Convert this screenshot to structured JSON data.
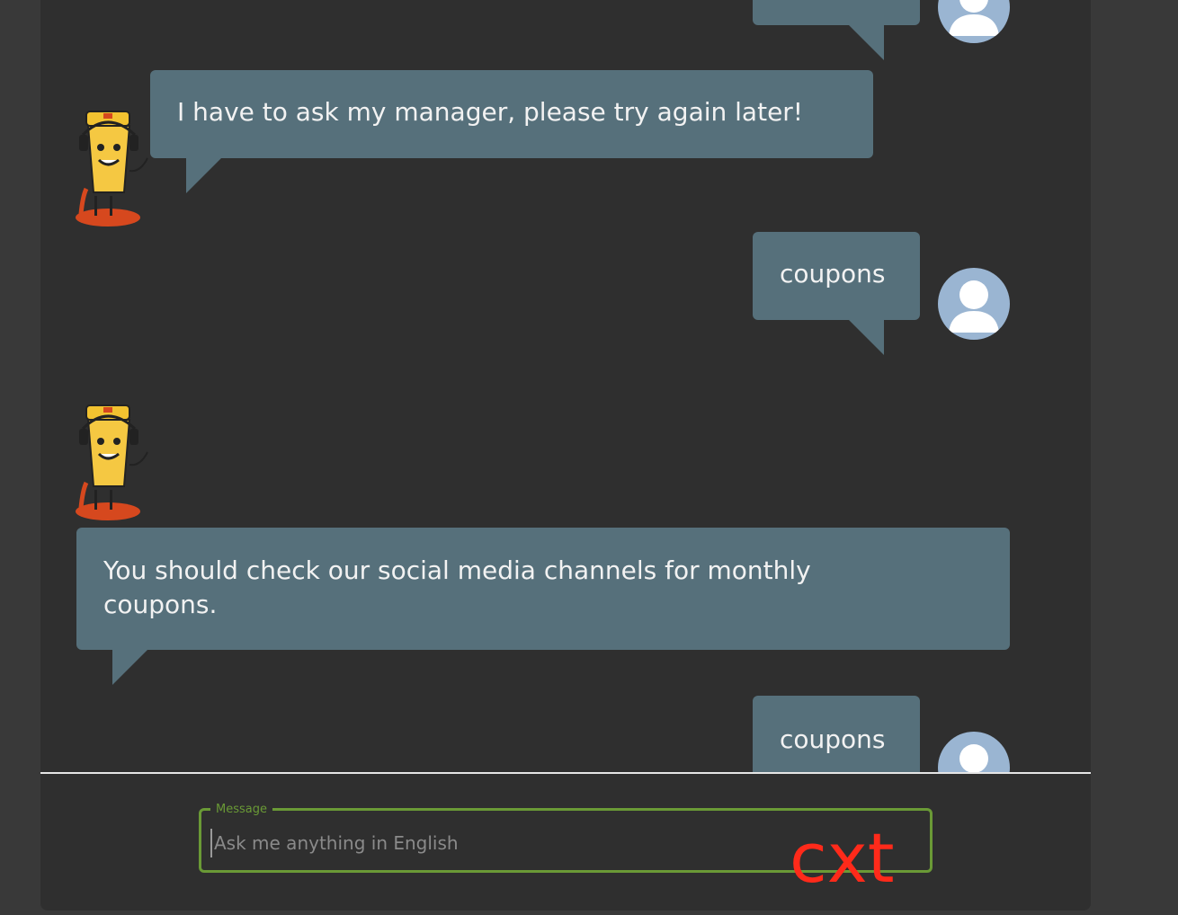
{
  "messages": [
    {
      "sender": "user",
      "text": ""
    },
    {
      "sender": "bot",
      "text": "I have to ask my manager, please try again later!"
    },
    {
      "sender": "user",
      "text": "coupons"
    },
    {
      "sender": "bot",
      "text": "You should check our social media channels for monthly coupons."
    },
    {
      "sender": "user",
      "text": "coupons"
    }
  ],
  "composer": {
    "legend": "Message",
    "placeholder": "Ask me anything in English"
  },
  "overlay": {
    "text": "cxt"
  },
  "colors": {
    "bubble": "#56707b",
    "panel": "#2f2f2f",
    "accent": "#6a9a36",
    "user_avatar": "#9ab5d2",
    "overlay": "#ff2a1a"
  },
  "icons": {
    "user_avatar": "user-avatar-icon",
    "bot_avatar": "robot-mascot-icon"
  }
}
